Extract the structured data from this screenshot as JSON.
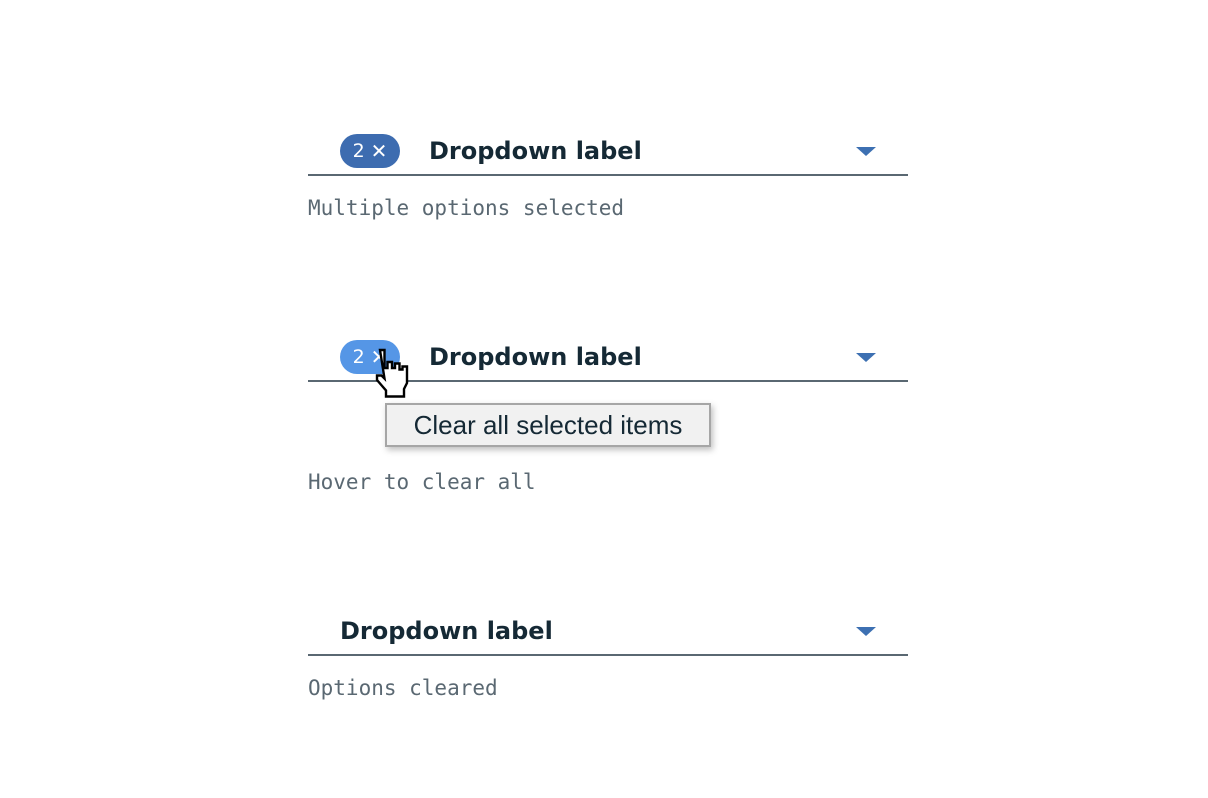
{
  "colors": {
    "tag_default": "#3d6cb0",
    "tag_hover": "#5596e6",
    "caret": "#3d70b2",
    "border": "#5a6872",
    "label": "#152935"
  },
  "examples": [
    {
      "count": "2",
      "clear_icon": "close-icon",
      "label": "Dropdown label",
      "caption": "Multiple options selected"
    },
    {
      "count": "2",
      "clear_icon": "close-icon",
      "label": "Dropdown label",
      "tooltip": "Clear all selected items",
      "caption": "Hover to clear all",
      "cursor": "hand-pointer-icon"
    },
    {
      "label": "Dropdown label",
      "caption": "Options cleared"
    }
  ]
}
